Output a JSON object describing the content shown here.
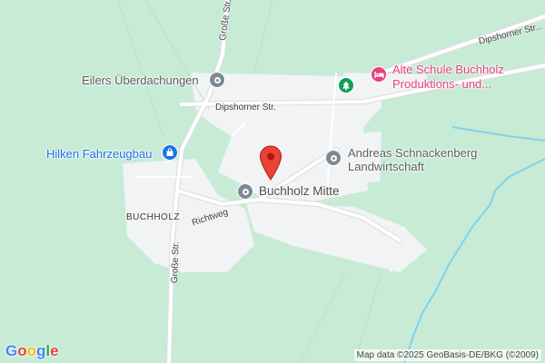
{
  "map": {
    "colors": {
      "background": "#c8ebd6",
      "built_area": "#f1f3f4",
      "road": "#ffffff",
      "water": "#7fd3ea",
      "poi_grey": "#7d8a93",
      "poi_pink": "#e7407f",
      "poi_green": "#0f9d58",
      "poi_blue": "#1a73e8",
      "marker": "#ea4335"
    },
    "area_label": "BUCHHOLZ",
    "streets": {
      "grosse_top": "Große Str.",
      "grosse_bottom": "Große Str.",
      "dipshorner_center": "Dipshorner Str.",
      "dipshorner_right": "Dipshorner Str...",
      "richtweg": "Richtweg"
    },
    "pois": {
      "eilers": {
        "label": "Eilers Überdachungen",
        "icon": "circle-poi-icon"
      },
      "hilken": {
        "label": "Hilken Fahrzeugbau",
        "icon": "shopping-bag-icon"
      },
      "alte_schule": {
        "line1": "Alte Schule Buchholz",
        "line2": "Produktions-  und...",
        "icon": "bed-icon"
      },
      "forest": {
        "icon": "tree-icon"
      },
      "schnackenberg": {
        "line1": "Andreas Schnackenberg",
        "line2": "Landwirtschaft",
        "icon": "circle-poi-icon"
      },
      "buchholz_mitte": {
        "label": "Buchholz Mitte",
        "icon": "circle-poi-icon"
      }
    },
    "marker": {
      "icon": "map-pin-icon"
    },
    "attribution": "Map data ©2025 GeoBasis-DE/BKG (©2009)",
    "logo": {
      "letters": [
        "G",
        "o",
        "o",
        "g",
        "l",
        "e"
      ],
      "colors": [
        "#4285f4",
        "#ea4335",
        "#fbbc05",
        "#4285f4",
        "#34a853",
        "#ea4335"
      ]
    }
  }
}
